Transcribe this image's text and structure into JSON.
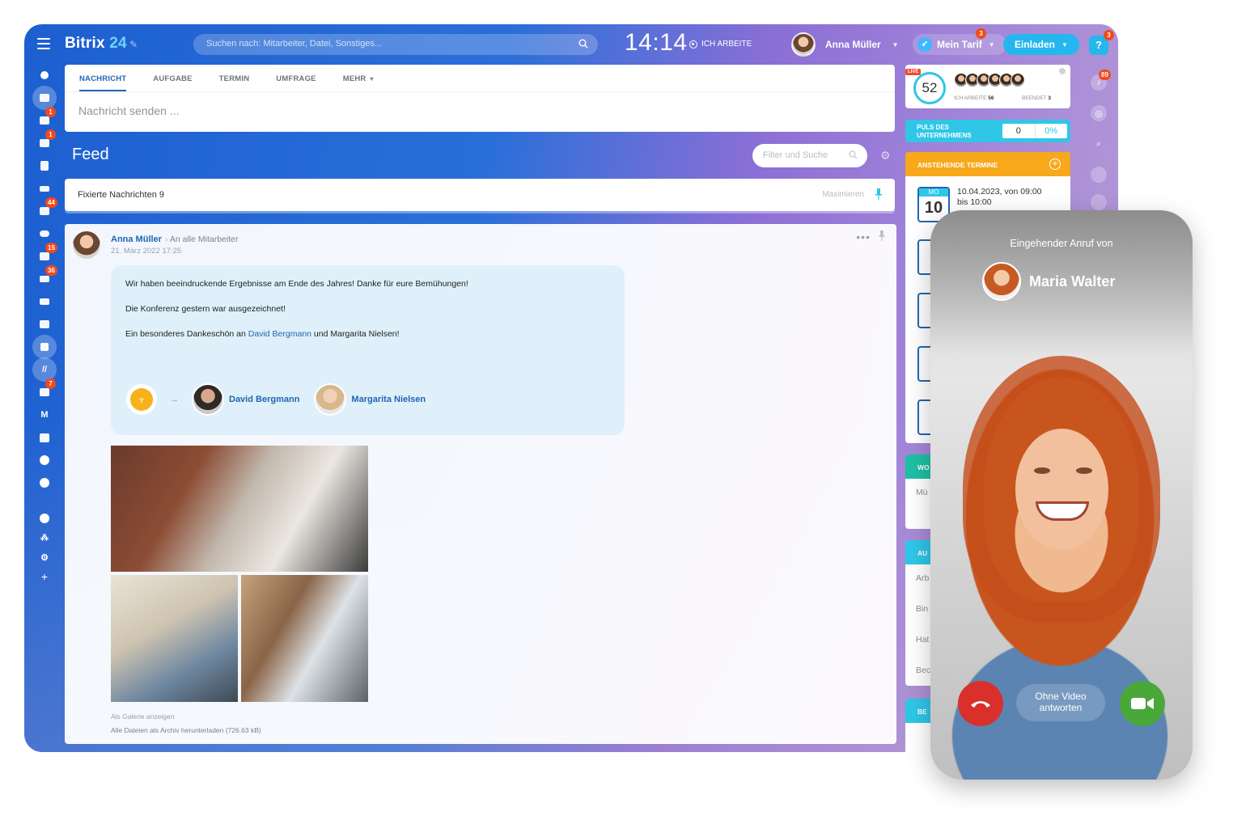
{
  "app": {
    "brand": "Bitrix",
    "brand_num": "24",
    "pen_icon": "pen-icon"
  },
  "topbar": {
    "search_placeholder": "Suchen nach: Mitarbeiter, Datei, Sonstiges...",
    "clock": "14:14",
    "work_status": "ICH ARBEITE",
    "user_name": "Anna Müller",
    "tariff_label": "Mein Tarif",
    "tariff_badge": "3",
    "invite_label": "Einladen",
    "help_badge": "3"
  },
  "sidebar": {
    "badges": {
      "chat": "1",
      "calendar": "1",
      "mail": "44",
      "tasks": "15",
      "crm": "36",
      "bot": "7"
    },
    "m_label": "M"
  },
  "composer": {
    "tabs": [
      "NACHRICHT",
      "AUFGABE",
      "TERMIN",
      "UMFRAGE",
      "MEHR"
    ],
    "placeholder": "Nachricht senden ..."
  },
  "feed": {
    "title": "Feed",
    "filter_placeholder": "Filter und Suche",
    "pinned_label": "Fixierte Nachrichten 9",
    "maximize_label": "Maximieren"
  },
  "post": {
    "author": "Anna Müller",
    "target": "An alle Mitarbeiter",
    "date": "21. März 2022 17:25",
    "line1": "Wir haben beeindruckende Ergebnisse am Ende des Jahres! Danke für eure Bemühungen!",
    "line2": "Die Konferenz gestern war ausgezeichnet!",
    "line3_pre": "Ein besonderes Dankeschön an ",
    "line3_link": "David Bergmann",
    "line3_post": " und Margarita Nielsen!",
    "praise_persons": [
      "David Bergmann",
      "Margarita Nielsen"
    ],
    "gallery_link": "Als Galerie anzeigen",
    "download_link": "Alle Dateien als Archiv herunterladen (726.63 kB)"
  },
  "right": {
    "live_tag": "LIVE",
    "live_count": "52",
    "working_label": "ICH ARBEITE",
    "working_count": "56",
    "finished_label": "BEENDET",
    "finished_count": "3",
    "pulse_label": "PULS DES UNTERNEHMENS",
    "pulse_value": "0",
    "pulse_percent": "0%",
    "events_title": "ANSTEHENDE TERMINE",
    "event_dow": "MO",
    "event_day": "10",
    "event_text_1": "10.04.2023, von 09:00",
    "event_text_2": "bis 10:00",
    "card_wo": "WO",
    "card_wo_row": "Mü",
    "card_au": "AU",
    "card_au_rows": [
      "Arb",
      "Bin",
      "Hat",
      "Bec"
    ],
    "card_be": "BE",
    "notif_badge": "89"
  },
  "phone": {
    "incoming_label": "Eingehender Anruf von",
    "caller_name": "Maria Walter",
    "no_video_label_1": "Ohne Video",
    "no_video_label_2": "antworten"
  },
  "colors": {
    "accent": "#2067b0",
    "cyan": "#2fc6e8",
    "orange": "#f7a81b",
    "decline": "#d9302c",
    "accept": "#4aa83a",
    "badge": "#f54819"
  }
}
